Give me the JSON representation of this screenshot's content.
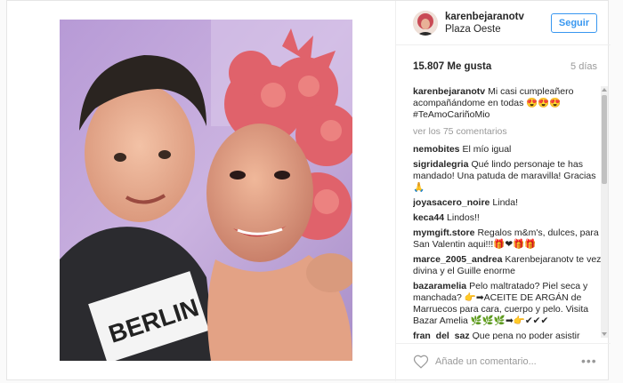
{
  "post": {
    "photo_shirt_text": "BERLIN"
  },
  "header": {
    "username": "karenbejaranotv",
    "location": "Plaza Oeste",
    "follow_label": "Seguir"
  },
  "stats": {
    "likes": "15.807 Me gusta",
    "age": "5 días"
  },
  "caption": {
    "user": "karenbejaranotv",
    "text": "Mi casi cumpleañero acompañándome en todas 😍😍😍 #TeAmoCariñoMio"
  },
  "view_all": "ver los 75 comentarios",
  "comments": [
    {
      "user": "nemobites",
      "text": "El mío igual"
    },
    {
      "user": "sigridalegria",
      "text": "Qué lindo personaje te has mandado! Una patuda de maravilla! Gracias 🙏"
    },
    {
      "user": "joyasacero_noire",
      "text": "Linda!"
    },
    {
      "user": "keca44",
      "text": "Lindos!!"
    },
    {
      "user": "mymgift.store",
      "text": "Regalos m&m's, dulces, para San Valentin aqui!!!🎁❤🎁🎁"
    },
    {
      "user": "marce_2005_andrea",
      "text": "Karenbejaranotv te vez divina y el Guille enorme"
    },
    {
      "user": "bazaramelia",
      "text": "Pelo maltratado? Piel seca y manchada? 👉➡ACEITE DE ARGÁN de Marruecos para cara, cuerpo y pelo. Visita Bazar Amelia 🌿🌿🌿➡👉✔✔✔"
    },
    {
      "user": "fran_del_saz",
      "text": "Que pena no poder asistir"
    }
  ],
  "footer": {
    "comment_placeholder": "Añade un comentario...",
    "more_label": "•••"
  },
  "icons": {
    "like": "heart-outline-icon",
    "more": "more-options-icon"
  }
}
